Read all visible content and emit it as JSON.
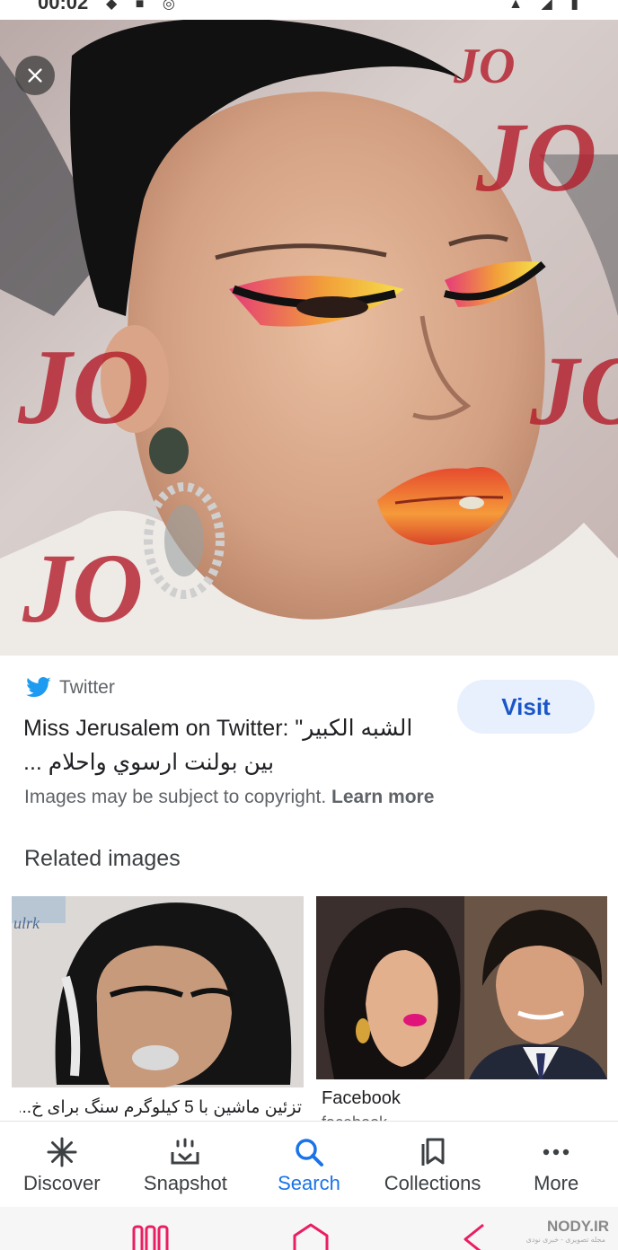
{
  "status_bar": {
    "time": "00:02",
    "left_icons": "◆ ■ ◎",
    "right_icons": "▲ ◢ ▮"
  },
  "hero": {
    "background_text": [
      "JO",
      "JO",
      "JO",
      "JO",
      "JO"
    ],
    "close_icon": "close-icon"
  },
  "result": {
    "source_name": "Twitter",
    "source_icon": "twitter-bird-icon",
    "title_line1": "Miss Jerusalem on Twitter: \"الشبه الكبير",
    "title_line2": "بين بولنت ارسوي واحلام ...",
    "visit_label": "Visit",
    "copyright_text": "Images may be subject to copyright.",
    "learn_more": "Learn more"
  },
  "related": {
    "title": "Related images",
    "items": [
      {
        "caption": "تزئین ماشین با 5 کیلوگرم سنگ برای خ...",
        "thumb_text": "ulrk"
      },
      {
        "caption": "Facebook",
        "sub": "facebook"
      }
    ]
  },
  "bottom_nav": {
    "items": [
      {
        "label": "Discover",
        "icon": "discover-icon"
      },
      {
        "label": "Snapshot",
        "icon": "snapshot-icon"
      },
      {
        "label": "Search",
        "icon": "search-icon"
      },
      {
        "label": "Collections",
        "icon": "collections-icon"
      },
      {
        "label": "More",
        "icon": "more-icon"
      }
    ]
  },
  "watermark": {
    "text": "NODY.IR",
    "sub": "مجله تصویری - خبری نودی"
  },
  "colors": {
    "accent": "#1a73e8",
    "visit_bg": "#e8f0fe",
    "twitter": "#1d9bf0",
    "system_nav_icons": "#e91e63"
  }
}
